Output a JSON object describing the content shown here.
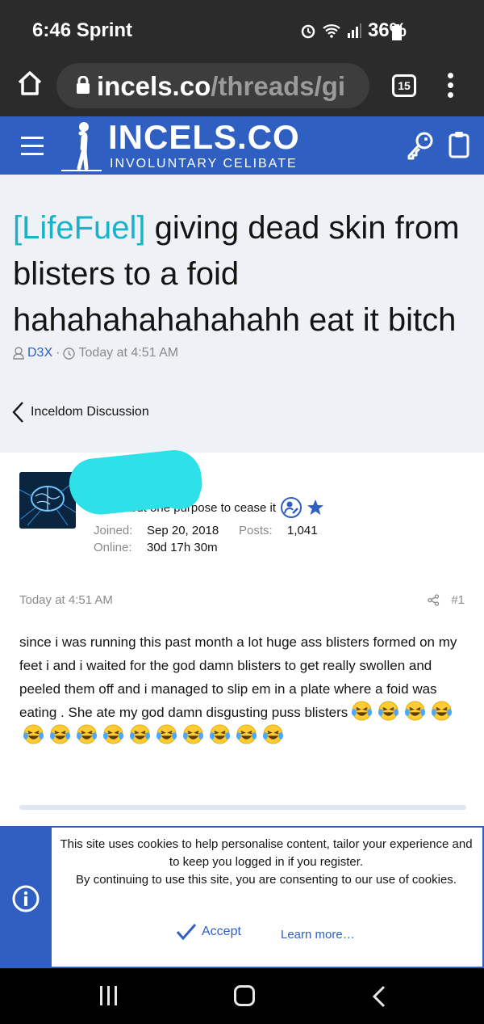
{
  "status_bar": {
    "time": "6:46 Sprint",
    "battery": "36%"
  },
  "browser": {
    "url_host": "incels.co",
    "url_path": "/threads/gi",
    "tab_count": "15"
  },
  "site": {
    "logo_title": "INCELS.CO",
    "logo_subtitle": "INVOLUNTARY CELIBATE"
  },
  "thread": {
    "prefix": "[LifeFuel]",
    "title": " giving dead skin from blisters to a foid hahahahahahahahh eat it bitch",
    "author": "D3X",
    "separator": "·",
    "date": "Today at 4:51 AM",
    "breadcrumb": "Inceldom Discussion"
  },
  "post": {
    "user_title": "I have but one purpose to cease it",
    "joined_label": "Joined:",
    "joined_value": "Sep 20, 2018",
    "posts_label": "Posts:",
    "posts_value": "1,041",
    "online_label": "Online:",
    "online_value": "30d 17h 30m",
    "date": "Today at 4:51 AM",
    "number": "#1",
    "body": "since i was running this past month a lot huge ass blisters formed on my feet i and i waited for the god damn blisters to get really swollen and peeled them off and i managed to slip em in a plate where a foid was eating . She ate my god damn disgusting puss blisters",
    "emoji_count": 14,
    "emoji": "loudly-crying-laughing-face"
  },
  "cookie": {
    "text_line1": "This site uses cookies to help personalise content, tailor your experience and to keep you logged in if you register.",
    "text_line2": "By continuing to use this site, you are consenting to our use of cookies.",
    "accept_label": "Accept",
    "learn_more_label": "Learn more…"
  },
  "colors": {
    "brand_blue": "#2f5fc0",
    "prefix_teal": "#17b3c8",
    "redaction": "#2ee0e8"
  }
}
